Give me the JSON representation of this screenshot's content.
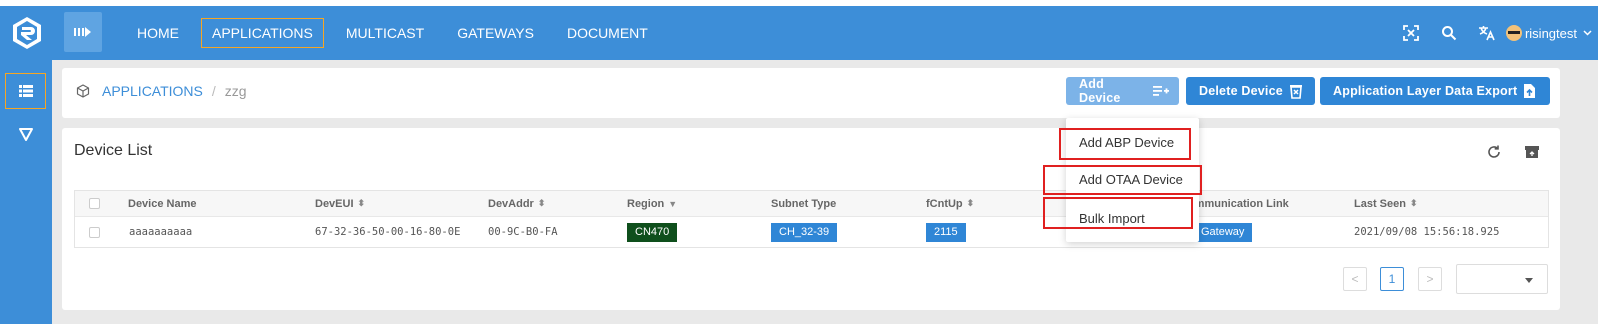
{
  "nav": {
    "items": [
      {
        "label": "HOME",
        "active": false
      },
      {
        "label": "APPLICATIONS",
        "active": true
      },
      {
        "label": "MULTICAST",
        "active": false
      },
      {
        "label": "GATEWAYS",
        "active": false
      },
      {
        "label": "DOCUMENT",
        "active": false
      }
    ],
    "user": "risingtest",
    "icons": [
      "fullscreen-icon",
      "search-icon",
      "translate-icon"
    ]
  },
  "sidebar": {
    "items": [
      "list-icon",
      "filter-icon"
    ]
  },
  "breadcrumb": {
    "root": "APPLICATIONS",
    "separator": "/",
    "current": "zzg"
  },
  "toolbar": {
    "add_device": "Add Device",
    "delete_device": "Delete Device",
    "export": "Application Layer Data Export"
  },
  "add_menu": {
    "items": [
      "Add ABP Device",
      "Add OTAA Device",
      "Bulk Import"
    ]
  },
  "device_list": {
    "title": "Device List",
    "columns": [
      "Device Name",
      "DevEUI",
      "DevAddr",
      "Region",
      "Subnet Type",
      "fCntUp",
      "Communication Link",
      "Last Seen"
    ],
    "rows": [
      {
        "name": "aaaaaaaaaa",
        "deveui": "67-32-36-50-00-16-80-0E",
        "devaddr": "00-9C-B0-FA",
        "region": "CN470",
        "subnet": "CH_32-39",
        "fcntup": "2115",
        "link": "Gateway",
        "last_seen": "2021/09/08 15:56:18.925"
      }
    ]
  },
  "pagination": {
    "current": "1",
    "prev": "<",
    "next": ">"
  },
  "colors": {
    "primary": "#3d8ed8",
    "button": "#2f86d6",
    "region_tag": "#0f4f1c",
    "highlight": "#e02020",
    "active_outline": "#f5a623"
  }
}
